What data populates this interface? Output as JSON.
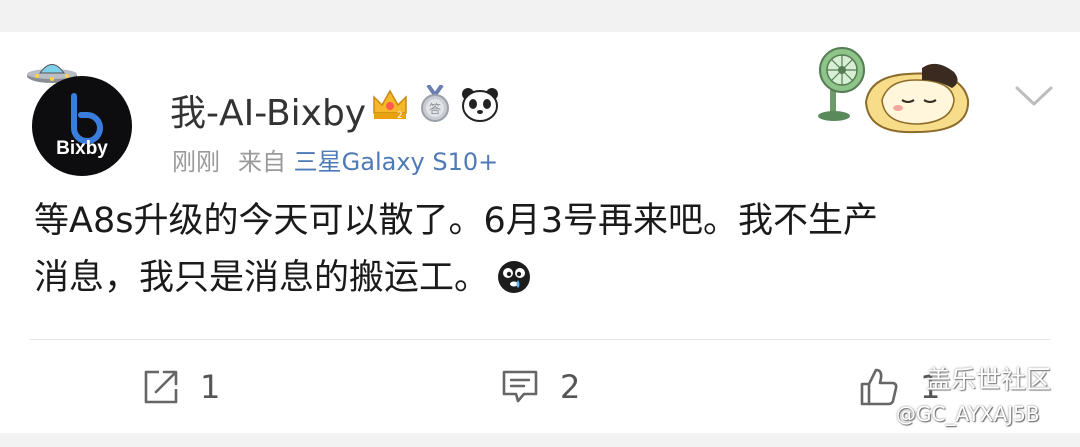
{
  "post": {
    "username": "我-AI-Bixby",
    "time": "刚刚",
    "from_label": "来自",
    "source": "三星Galaxy S10+",
    "content_line1": "等A8s升级的今天可以散了。6月3号再来吧。我不生产",
    "content_line2": "消息，我只是消息的搬运工。",
    "avatar_text": "Bixby"
  },
  "actions": {
    "share_count": "1",
    "comment_count": "2",
    "like_count": "1"
  },
  "watermark": {
    "community": "盖乐世社区",
    "user_id": "@GC_AYXAJ5B"
  },
  "icons": {
    "avatar_badge": "ufo-icon",
    "badges": [
      "crown-badge-icon",
      "medal-badge-icon",
      "panda-badge-icon"
    ],
    "decoration": "sleeping-bread-fan-icon",
    "menu": "chevron-down-icon",
    "emoji": "cry-face-icon",
    "share": "share-icon",
    "comment": "comment-icon",
    "like": "thumbs-up-icon"
  },
  "colors": {
    "background": "#ffffff",
    "separator": "#f2f2f2",
    "source_link": "#4e7ab5",
    "meta_gray": "#9a9a9a",
    "avatar_blue": "#3b7ddd"
  }
}
